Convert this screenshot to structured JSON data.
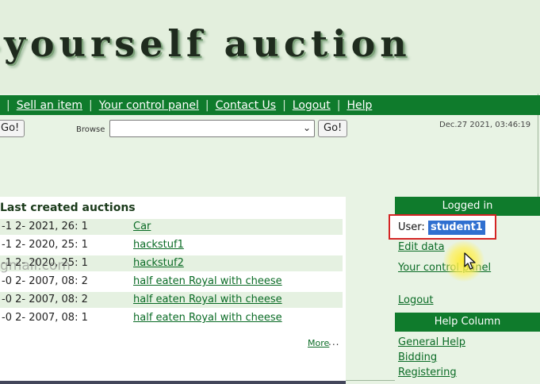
{
  "banner": {
    "title": "-yourself auction"
  },
  "nav": {
    "items": [
      "Sell an item",
      "Your control panel",
      "Contact Us",
      "Logout",
      "Help"
    ]
  },
  "toolbar": {
    "search_go_label": "Go!",
    "browse_label": "Browse",
    "browse_value": "",
    "browse_go_label": "Go!",
    "datetime": "Dec.27 2021, 03:46:19"
  },
  "auctions": {
    "title": "Last created auctions",
    "rows": [
      {
        "when": "-1 2- 2021, 26: 1",
        "item": "Car"
      },
      {
        "when": "-1 2- 2020, 25: 1",
        "item": "hackstuf1"
      },
      {
        "when": "-1 2- 2020, 25: 1",
        "item": "hackstuf2"
      },
      {
        "when": "-0 2- 2007, 08: 2",
        "item": "half eaten Royal with cheese"
      },
      {
        "when": "-0 2- 2007, 08: 2",
        "item": "half eaten Royal with cheese"
      },
      {
        "when": "-0 2- 2007, 08: 1",
        "item": "half eaten Royal with cheese"
      }
    ],
    "more_label": "More",
    "more_dots": "..."
  },
  "watermark": "gmail.com",
  "sidebar": {
    "logged_in_header": "Logged in",
    "user_label": "User:",
    "username": "student1",
    "edit_data": "Edit data",
    "control_panel": "Your control panel",
    "logout": "Logout",
    "help_header": "Help Column",
    "help_links": [
      "General Help",
      "Bidding",
      "Registering"
    ]
  },
  "colors": {
    "nav_green": "#0f7b2c",
    "page_bg": "#e8f3e4",
    "highlight_red": "#d42424",
    "selection_blue": "#2f6fd0"
  }
}
